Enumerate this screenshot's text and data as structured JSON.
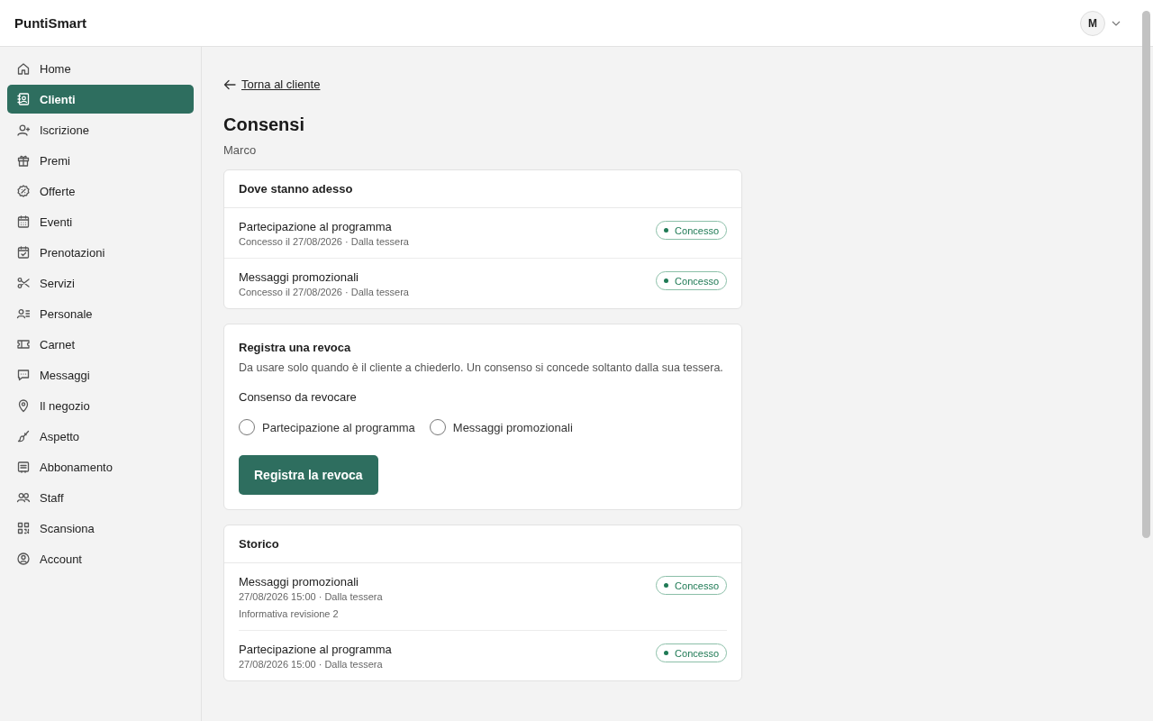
{
  "app": {
    "title": "PuntiSmart",
    "avatar": "M"
  },
  "sidebar": {
    "items": [
      {
        "label": "Home",
        "selected": false
      },
      {
        "label": "Clienti",
        "selected": true
      },
      {
        "label": "Iscrizione",
        "selected": false
      },
      {
        "label": "Premi",
        "selected": false
      },
      {
        "label": "Offerte",
        "selected": false
      },
      {
        "label": "Eventi",
        "selected": false
      },
      {
        "label": "Prenotazioni",
        "selected": false
      },
      {
        "label": "Servizi",
        "selected": false
      },
      {
        "label": "Personale",
        "selected": false
      },
      {
        "label": "Carnet",
        "selected": false
      },
      {
        "label": "Messaggi",
        "selected": false
      },
      {
        "label": "Il negozio",
        "selected": false
      },
      {
        "label": "Aspetto",
        "selected": false
      },
      {
        "label": "Abbonamento",
        "selected": false
      },
      {
        "label": "Staff",
        "selected": false
      },
      {
        "label": "Scansiona",
        "selected": false
      },
      {
        "label": "Account",
        "selected": false
      }
    ]
  },
  "back_link": "Torna al cliente",
  "page": {
    "title": "Consensi",
    "subtitle": "Marco"
  },
  "current": {
    "title": "Dove stanno adesso",
    "rows": [
      {
        "name": "Partecipazione al programma",
        "meta": "Concesso il 27/08/2026 · Dalla tessera",
        "status": "Concesso"
      },
      {
        "name": "Messaggi promozionali",
        "meta": "Concesso il 27/08/2026 · Dalla tessera",
        "status": "Concesso"
      }
    ]
  },
  "revoke": {
    "title": "Registra una revoca",
    "description": "Da usare solo quando è il cliente a chiederlo. Un consenso si concede soltanto dalla sua tessera.",
    "field_label": "Consenso da revocare",
    "options": [
      {
        "label": "Partecipazione al programma",
        "selected": false
      },
      {
        "label": "Messaggi promozionali",
        "selected": false
      }
    ],
    "button": "Registra la revoca"
  },
  "history": {
    "title": "Storico",
    "rows": [
      {
        "name": "Messaggi promozionali",
        "meta": "27/08/2026 15:00 · Dalla tessera",
        "note": "Informativa revisione 2",
        "status": "Concesso"
      },
      {
        "name": "Partecipazione al programma",
        "meta": "27/08/2026 15:00 · Dalla tessera",
        "status": "Concesso"
      }
    ]
  }
}
